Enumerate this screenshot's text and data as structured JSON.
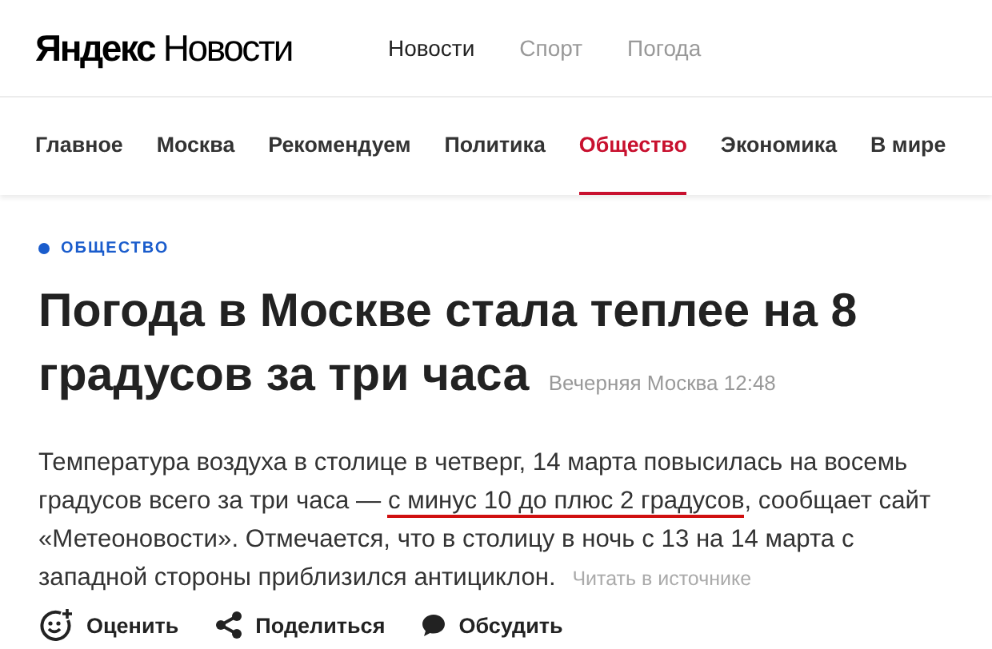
{
  "logo": {
    "brand": "Яндекс",
    "product": "Новости"
  },
  "top_nav": [
    {
      "label": "Новости",
      "selected": true
    },
    {
      "label": "Спорт",
      "selected": false
    },
    {
      "label": "Погода",
      "selected": false
    }
  ],
  "sections": [
    {
      "label": "Главное",
      "selected": false
    },
    {
      "label": "Москва",
      "selected": false
    },
    {
      "label": "Рекомендуем",
      "selected": false
    },
    {
      "label": "Политика",
      "selected": false
    },
    {
      "label": "Общество",
      "selected": true
    },
    {
      "label": "Экономика",
      "selected": false
    },
    {
      "label": "В мире",
      "selected": false
    }
  ],
  "article": {
    "rubric": {
      "label": "ОБЩЕСТВО",
      "color": "#1a5ccc"
    },
    "headline": "Погода в Москве стала теплее на 8 градусов за три часа",
    "source": "Вечерняя Москва 12:48",
    "body_before": "Температура воздуха в столице в четверг, 14 марта повысилась на восемь градусов всего за три часа — ",
    "body_underlined": "с минус 10 до плюс 2 градусов",
    "body_after": ", сообщает сайт «Метеоновости». Отмечается, что в столицу в ночь с 13 на 14 марта с западной стороны приблизился антициклон.",
    "source_link": "Читать в источнике"
  },
  "actions": [
    {
      "kind": "rate",
      "label": "Оценить"
    },
    {
      "kind": "share",
      "label": "Поделиться"
    },
    {
      "kind": "discuss",
      "label": "Обсудить"
    }
  ]
}
